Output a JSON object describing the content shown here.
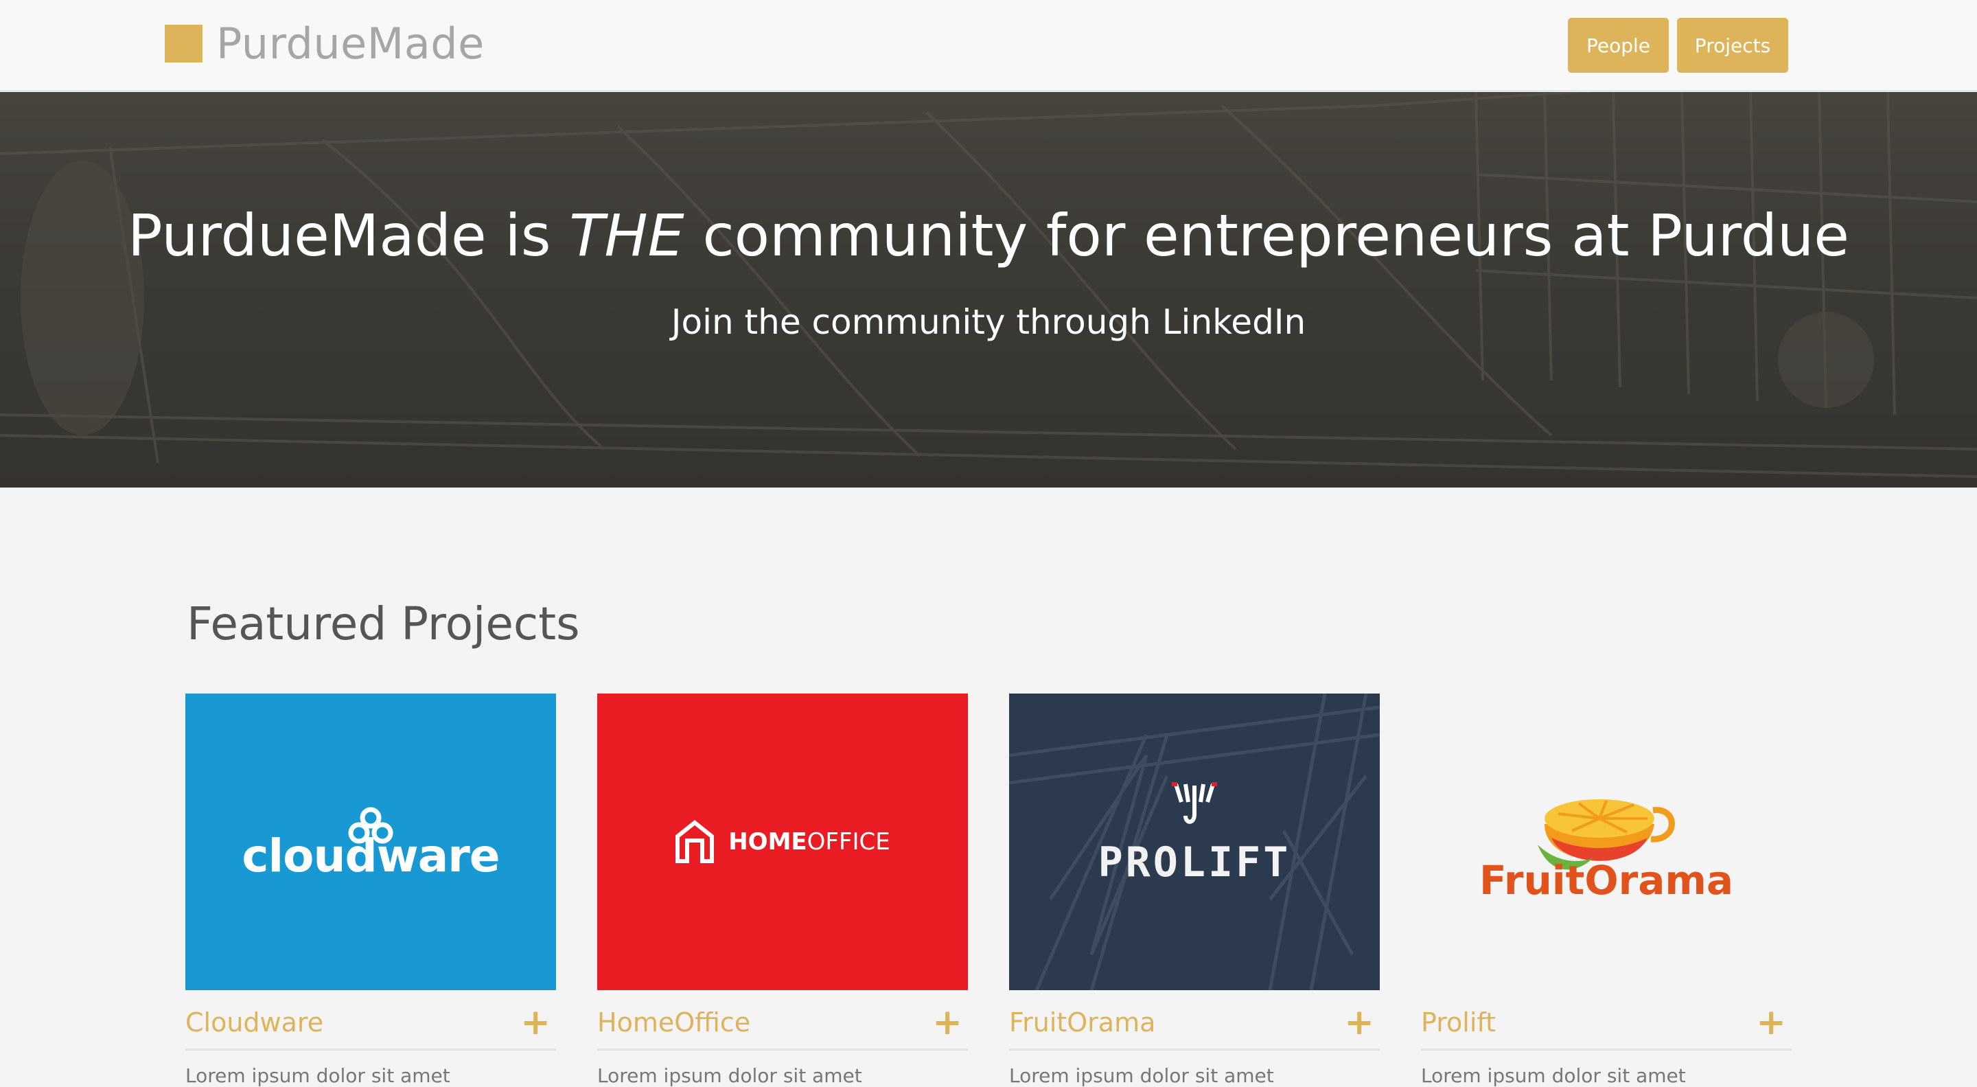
{
  "navbar": {
    "brand": "PurdueMade",
    "people_label": "People",
    "projects_label": "Projects",
    "accent_color": "#ddb45a"
  },
  "hero": {
    "title_before": "PurdueMade is ",
    "title_emphasis": "THE",
    "title_after": " community for entrepreneurs at Purdue",
    "subtitle": "Join the community through LinkedIn"
  },
  "featured": {
    "heading": "Featured Projects",
    "cards": [
      {
        "name": "Cloudware",
        "logo_text": "cloudware",
        "logo_bg": "#1899d4",
        "plus_icon": "plus-icon",
        "desc": "Lorem ipsum dolor sit amet"
      },
      {
        "name": "HomeOffice",
        "logo_text_bold": "HOME",
        "logo_text_light": "OFFICE",
        "logo_bg": "#e91c24",
        "plus_icon": "plus-icon",
        "desc": "Lorem ipsum dolor sit amet"
      },
      {
        "name": "FruitOrama",
        "logo_text": "PROLIFT",
        "logo_bg": "#2b3a4f",
        "plus_icon": "plus-icon",
        "desc": "Lorem ipsum dolor sit amet"
      },
      {
        "name": "Prolift",
        "logo_text": "FruitOrama",
        "logo_bg": "#f4f4f4",
        "plus_icon": "plus-icon",
        "desc": "Lorem ipsum dolor sit amet"
      }
    ]
  }
}
